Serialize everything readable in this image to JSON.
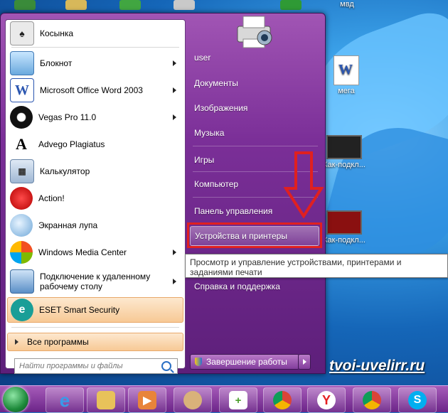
{
  "start_menu": {
    "pinned": [
      {
        "label": "Косынка",
        "icon": "solitaire-icon",
        "submenu": false
      },
      {
        "label": "Блокнот",
        "icon": "notepad-icon",
        "submenu": true
      },
      {
        "label": "Microsoft Office Word 2003",
        "icon": "word-icon",
        "submenu": true
      },
      {
        "label": "Vegas Pro 11.0",
        "icon": "vegas-icon",
        "submenu": true
      },
      {
        "label": "Advego Plagiatus",
        "icon": "advego-icon",
        "submenu": false
      },
      {
        "label": "Калькулятор",
        "icon": "calculator-icon",
        "submenu": false
      },
      {
        "label": "Action!",
        "icon": "action-icon",
        "submenu": false
      },
      {
        "label": "Экранная лупа",
        "icon": "magnifier-icon",
        "submenu": false
      },
      {
        "label": "Windows Media Center",
        "icon": "media-center-icon",
        "submenu": true
      },
      {
        "label": "Подключение к удаленному рабочему столу",
        "icon": "remote-desktop-icon",
        "submenu": true
      },
      {
        "label": "ESET Smart Security",
        "icon": "eset-icon",
        "submenu": false
      }
    ],
    "all_programs": "Все программы",
    "search_placeholder": "Найти программы и файлы",
    "right_items": [
      "user",
      "Документы",
      "Изображения",
      "Музыка",
      "Игры",
      "Компьютер",
      "Панель управления",
      "Устройства и принтеры",
      "Справка и поддержка"
    ],
    "shutdown_label": "Завершение работы"
  },
  "tooltip": "Просмотр и управление устройствами, принтерами и заданиями печати",
  "desktop_icons": {
    "mvd": "мвд",
    "mega": "мега",
    "laptop1": "Как-подкл...",
    "laptop2": "Как-подкл..."
  },
  "watermark": "tvoi-uvelirr.ru",
  "taskbar": {
    "apps": [
      "internet-explorer-icon",
      "explorer-icon",
      "media-player-icon",
      "paint-icon",
      "notepad-plus-icon",
      "chrome-icon",
      "yandex-icon",
      "chrome-canary-icon",
      "skype-icon"
    ]
  },
  "colors": {
    "highlight": "#f7c995",
    "menu_purple": "#7b2f98",
    "annotation_red": "#e02020"
  }
}
